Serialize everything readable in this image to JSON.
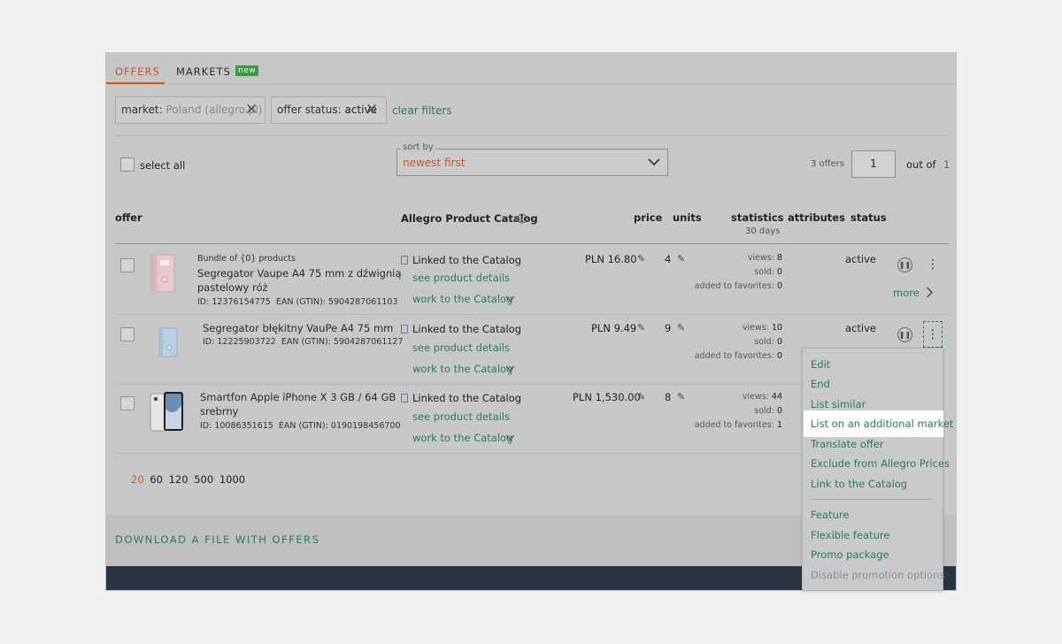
{
  "tabs": [
    {
      "label": "OFFERS"
    },
    {
      "label": "MARKETS"
    }
  ],
  "tabs_badge": "new",
  "filters": {
    "market_label": "market:",
    "market_value": "Poland (allegro.pl)",
    "status_label": "offer status:",
    "status_value": "active",
    "clear": "clear filters"
  },
  "toolbar": {
    "select_all": "select all",
    "sort_legend": "sort by",
    "sort_value": "newest first",
    "offers_count": "3 offers",
    "page": "1",
    "out_of": "out of",
    "total_pages": "1"
  },
  "columns": {
    "offer": "offer",
    "catalog": "Allegro Product Catalog",
    "price": "price",
    "units": "units",
    "statistics": "statistics",
    "statistics_sub": "30 days",
    "attributes": "attributes",
    "status": "status"
  },
  "rows": [
    {
      "bundle": "Bundle of {0} products",
      "title_line1": "Segregator Vaupe A4 75 mm z dźwignią",
      "title_line2": "pastelowy róż",
      "id_label": "ID:",
      "id": "12376154775",
      "ean_label": "EAN (GTIN):",
      "ean": "5904287061103",
      "catalog_status": "Linked to the Catalog",
      "see_details": "see product details",
      "work": "work to the Catalog",
      "price": "PLN 16.80",
      "units": "4",
      "views_label": "views:",
      "views": "8",
      "sold_label": "sold:",
      "sold": "0",
      "fav_label": "added to favorites:",
      "fav": "0",
      "status": "active",
      "more": "more"
    },
    {
      "title_line1": "Segregator błękitny VauPe A4 75 mm",
      "id_label": "ID:",
      "id": "12225903722",
      "ean_label": "EAN (GTIN):",
      "ean": "5904287061127",
      "catalog_status": "Linked to the Catalog",
      "see_details": "see product details",
      "work": "work to the Catalog",
      "price": "PLN 9.49",
      "units": "9",
      "views_label": "views:",
      "views": "10",
      "sold_label": "sold:",
      "sold": "0",
      "fav_label": "added to favorites:",
      "fav": "0",
      "status": "active"
    },
    {
      "title_line1": "Smartfon Apple iPhone X 3 GB / 64 GB",
      "title_line2": "srebrny",
      "id_label": "ID:",
      "id": "10086351615",
      "ean_label": "EAN (GTIN):",
      "ean": "0190198456700",
      "catalog_status": "Linked to the Catalog",
      "see_details": "see product details",
      "work": "work to the Catalog",
      "price": "PLN 1,530.00",
      "units": "8",
      "views_label": "views:",
      "views": "44",
      "sold_label": "sold:",
      "sold": "0",
      "fav_label": "added to favorites:",
      "fav": "1"
    }
  ],
  "page_sizes": [
    "20",
    "60",
    "120",
    "500",
    "1000"
  ],
  "page_size_selected": "20",
  "download": "DOWNLOAD A FILE WITH OFFERS",
  "menu": {
    "items": [
      "Edit",
      "End",
      "List similar",
      "List on an additional market",
      "Translate offer",
      "Exclude from Allegro Prices",
      "Link to the Catalog"
    ],
    "promo_items": [
      "Feature",
      "Flexible feature",
      "Promo package"
    ],
    "disabled_item": "Disable promotion options",
    "highlighted": "List on an additional market"
  },
  "colors": {
    "accent_orange": "#c6571f",
    "link_green": "#2c7a58",
    "badge_green": "#3a9a3e",
    "footer_dark": "#293540"
  },
  "icons": [
    "close-icon",
    "chevron-down-icon",
    "info-icon",
    "catalog-document-icon",
    "pencil-icon",
    "pause-icon",
    "kebab-icon",
    "chevron-right-icon"
  ]
}
